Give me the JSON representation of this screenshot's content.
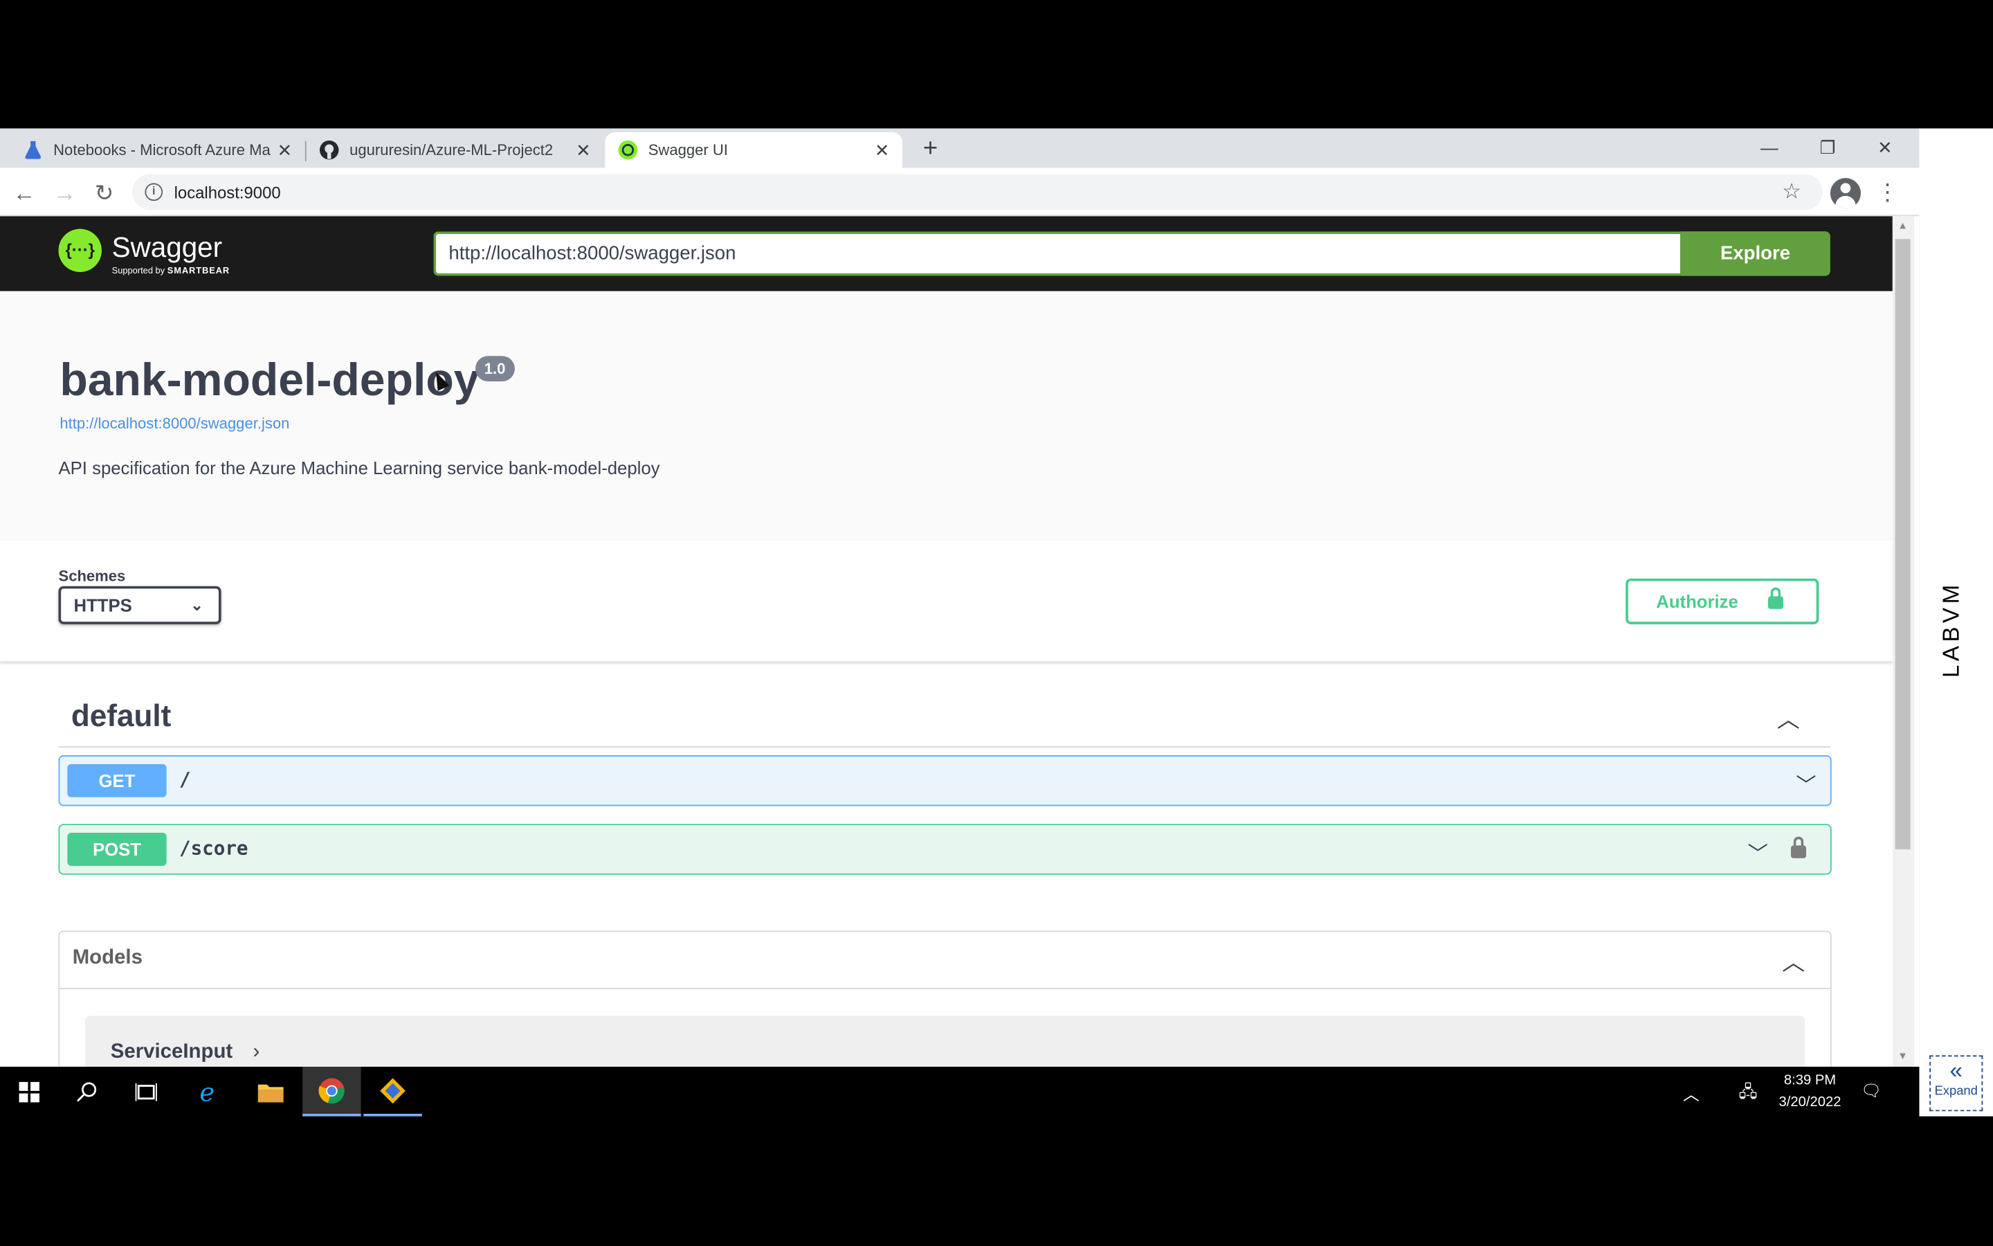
{
  "browser": {
    "tabs": [
      {
        "title": "Notebooks - Microsoft Azure Ma",
        "icon": "flask-icon"
      },
      {
        "title": "ugururesin/Azure-ML-Project2",
        "icon": "github-icon"
      },
      {
        "title": "Swagger UI",
        "icon": "swagger-icon",
        "active": true
      }
    ],
    "new_tab": "+",
    "close_glyph": "✕",
    "url": "localhost:9000",
    "info_glyph": "i"
  },
  "swagger": {
    "brand": "Swagger",
    "brand_mark": "{···}",
    "supported_by": "Supported by",
    "smartbear": "SMARTBEAR",
    "spec_url_input": "http://localhost:8000/swagger.json",
    "explore_label": "Explore",
    "api_title": "bank-model-deploy",
    "version": "1.0",
    "spec_link": "http://localhost:8000/swagger.json",
    "description": "API specification for the Azure Machine Learning service bank-model-deploy",
    "schemes_label": "Schemes",
    "scheme_selected": "HTTPS",
    "authorize_label": "Authorize",
    "tag_name": "default",
    "operations": [
      {
        "method": "GET",
        "path": "/"
      },
      {
        "method": "POST",
        "path": "/score"
      }
    ],
    "models_title": "Models",
    "models": [
      "ServiceInput"
    ]
  },
  "side_panel": {
    "label": "LABVM",
    "expand_label": "Expand",
    "expand_glyph": "«"
  },
  "taskbar": {
    "time": "8:39 PM",
    "date": "3/20/2022"
  },
  "colors": {
    "get": "#61affe",
    "post": "#49cc90",
    "explore": "#62a03f"
  }
}
